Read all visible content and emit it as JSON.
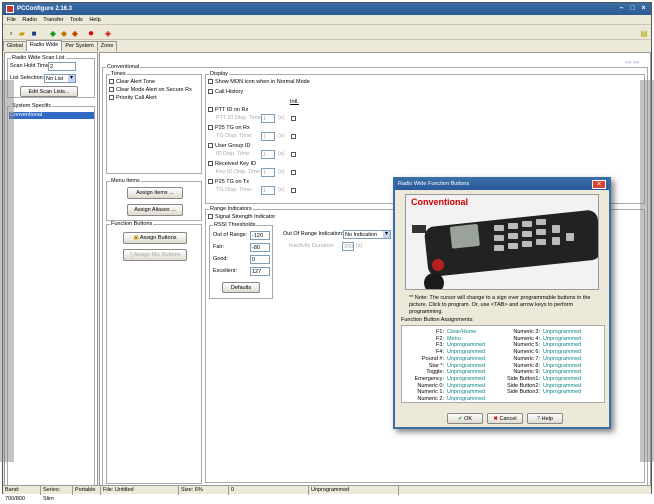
{
  "window": {
    "title": "PCConfigure 2.16.3"
  },
  "menu": [
    "File",
    "Radio",
    "Transfer",
    "Tools",
    "Help"
  ],
  "tabs": [
    "Global",
    "Radio Wide",
    "Per System",
    "Zone"
  ],
  "left": {
    "scanlist_group": "Radio Wide Scan List",
    "scan_hold_label": "Scan Hold Time:",
    "scan_hold_value": "2",
    "list_sel_label": "List Selection:",
    "list_sel_value": "No List",
    "edit_scan": "Edit Scan Lists...",
    "system_group": "System Specific",
    "system_item": "Conventional"
  },
  "conventional": {
    "group": "Conventional",
    "tones": {
      "label": "Tones",
      "items": [
        "Clear Alert Tone",
        "Clear Mode Alert on Secure Rx",
        "Priority Call Alert"
      ]
    },
    "menu_items": {
      "label": "Menu Items",
      "assign_items": "Assign Items ...",
      "assign_aliases": "Assign Aliases ..."
    },
    "function_buttons": {
      "label": "Function Buttons",
      "assign_buttons": "Assign Buttons",
      "assign_mic": "Assign Mic Buttons"
    },
    "display": {
      "label": "Display",
      "show_mon": "Show MON icon when in Normal Mode",
      "call_history": "Call History",
      "intl": "Intl.",
      "ptt_rx": "PTT ID on Rx",
      "ptt_disp": "PTT ID Disp. Time:",
      "p25_rx": "P25 TG on Rx",
      "tg_disp": "TG Disp. Time:",
      "user_group": "User Group ID",
      "id_disp": "ID Disp. Time:",
      "received_key": "Received Key ID",
      "key_disp": "Key ID Disp. Time:",
      "p25_tx": "P25 TG on Tx",
      "tg_disp2": "TG Disp. Time:",
      "time_value": "1",
      "unit": "(s)"
    },
    "range": {
      "label": "Range Indicators",
      "signal": "Signal Strength Indicator",
      "rssi_group": "RSSI Thresholds",
      "out_label": "Out of Range:",
      "out_value": "-120",
      "fair_label": "Fair:",
      "fair_value": "-80",
      "good_label": "Good:",
      "good_value": "0",
      "excellent_label": "Excellent:",
      "excellent_value": "127",
      "defaults": "Defaults",
      "oor_ind_label": "Out Of Range Indication:",
      "oor_ind_value": "No Indication",
      "inactivity_label": "Inactivity Duration:",
      "inactivity_value": "200",
      "inactivity_unit": "(s)"
    },
    "nav": "<<  >>"
  },
  "status": {
    "band": "Band: 700/800",
    "series": "Series: Slim",
    "type": "Portable",
    "file": "File: Untitled",
    "size": "Size: 6%",
    "field": "0",
    "state": "Unprogrammed"
  },
  "dialog": {
    "title": "Radio Wide Function Buttons",
    "heading": "Conventional",
    "note": "** Note:  The cursor will change to a   sign over programmable buttons in the picture.  Click to program.  Or, use <TAB> and arrow keys to perform programming.",
    "assign_label": "Function Button Assignments:",
    "left": [
      {
        "k": "F1:",
        "v": "Clear/Home"
      },
      {
        "k": "F2:",
        "v": "Menu"
      },
      {
        "k": "F3:",
        "v": "Unprogrammed"
      },
      {
        "k": "F4:",
        "v": "Unprogrammed"
      },
      {
        "k": "Pound #:",
        "v": "Unprogrammed"
      },
      {
        "k": "Star *:",
        "v": "Unprogrammed"
      },
      {
        "k": "Toggle:",
        "v": "Unprogrammed"
      },
      {
        "k": "Emergency:",
        "v": "Unprogrammed"
      },
      {
        "k": "Numeric 0:",
        "v": "Unprogrammed"
      },
      {
        "k": "Numeric 1:",
        "v": "Unprogrammed"
      },
      {
        "k": "Numeric 2:",
        "v": "Unprogrammed"
      }
    ],
    "right": [
      {
        "k": "Numeric 3:",
        "v": "Unprogrammed"
      },
      {
        "k": "Numeric 4:",
        "v": "Unprogrammed"
      },
      {
        "k": "Numeric 5:",
        "v": "Unprogrammed"
      },
      {
        "k": "Numeric 6:",
        "v": "Unprogrammed"
      },
      {
        "k": "Numeric 7:",
        "v": "Unprogrammed"
      },
      {
        "k": "Numeric 8:",
        "v": "Unprogrammed"
      },
      {
        "k": "Numeric 9:",
        "v": "Unprogrammed"
      },
      {
        "k": "Side Button1:",
        "v": "Unprogrammed"
      },
      {
        "k": "Side Button2:",
        "v": "Unprogrammed"
      },
      {
        "k": "Side Button3:",
        "v": "Unprogrammed"
      }
    ],
    "ok": "OK",
    "cancel": "Cancel",
    "help": "Help"
  },
  "colors": {
    "accent": "#3a6ea5",
    "link": "#0a8a8a",
    "heading": "#cc0000"
  }
}
